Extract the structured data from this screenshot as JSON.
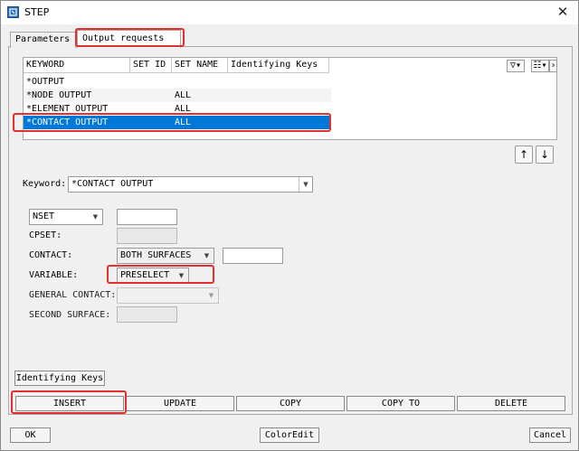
{
  "window": {
    "title": "STEP",
    "close_glyph": "✕"
  },
  "tabs": [
    {
      "label": "Parameters",
      "active": false
    },
    {
      "label": "Output requests",
      "active": true
    }
  ],
  "list": {
    "columns": [
      "KEYWORD",
      "SET ID",
      "SET NAME",
      "Identifying Keys"
    ],
    "rows": [
      {
        "keyword": "*OUTPUT",
        "set_id": "",
        "set_name": ""
      },
      {
        "keyword": "*NODE OUTPUT",
        "set_id": "",
        "set_name": "ALL"
      },
      {
        "keyword": "*ELEMENT OUTPUT",
        "set_id": "",
        "set_name": "ALL"
      },
      {
        "keyword": "*CONTACT OUTPUT",
        "set_id": "",
        "set_name": "ALL"
      }
    ],
    "selected_index": 3,
    "tools": {
      "filter_glyph": "▽▾",
      "columns_glyph": "☷▾",
      "more_glyph": "›"
    }
  },
  "move": {
    "up_glyph": "↑",
    "down_glyph": "↓"
  },
  "form": {
    "keyword_label": "Keyword:",
    "keyword_value": "*CONTACT OUTPUT",
    "nset_value": "NSET",
    "cpset_label": "CPSET:",
    "contact_label": "CONTACT:",
    "contact_value": "BOTH SURFACES",
    "variable_label": "VARIABLE:",
    "variable_value": "PRESELECT",
    "general_contact_label": "GENERAL CONTACT:",
    "general_contact_value": "",
    "second_surface_label": "SECOND SURFACE:",
    "dropdown_glyph": "▼"
  },
  "identifying_keys_button": "Identifying Keys",
  "actions": [
    "INSERT",
    "UPDATE",
    "COPY",
    "COPY TO",
    "DELETE"
  ],
  "footer": {
    "ok": "OK",
    "coloredit": "ColorEdit",
    "cancel": "Cancel"
  },
  "colors": {
    "selection": "#0078d7",
    "highlight_box": "#e03030"
  }
}
